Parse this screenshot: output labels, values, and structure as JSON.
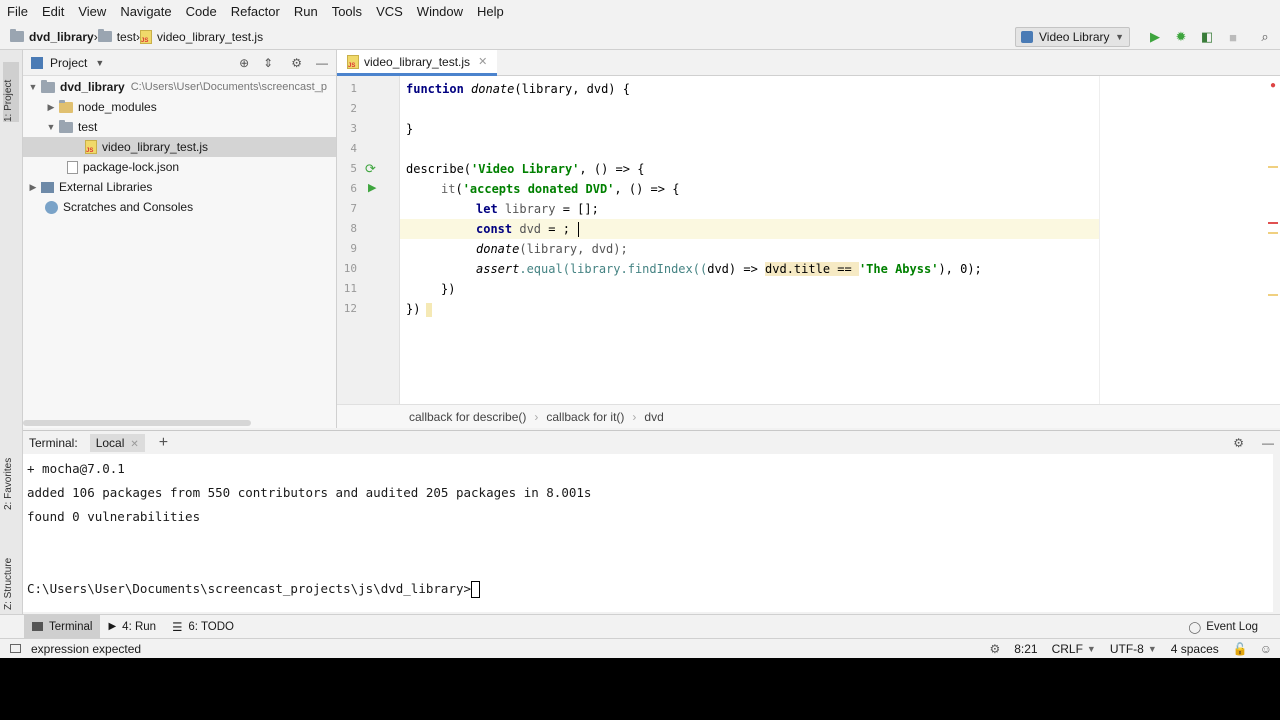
{
  "menu": [
    "File",
    "Edit",
    "View",
    "Navigate",
    "Code",
    "Refactor",
    "Run",
    "Tools",
    "VCS",
    "Window",
    "Help"
  ],
  "nav": {
    "project": "dvd_library",
    "folder": "test",
    "file": "video_library_test.js"
  },
  "run_config": "Video Library",
  "left_strip": {
    "project": "1: Project",
    "favorites": "2: Favorites",
    "structure": "Z: Structure"
  },
  "project_panel": {
    "title": "Project",
    "root": "dvd_library",
    "root_path": "C:\\Users\\User\\Documents\\screencast_p",
    "items": [
      "node_modules",
      "test",
      "video_library_test.js",
      "package-lock.json",
      "External Libraries",
      "Scratches and Consoles"
    ]
  },
  "editor": {
    "tab": "video_library_test.js",
    "line_numbers": [
      "1",
      "2",
      "3",
      "4",
      "5",
      "6",
      "7",
      "8",
      "9",
      "10",
      "11",
      "12"
    ],
    "code": {
      "l1_kw": "function",
      "l1_fn": "donate",
      "l1_rest": "(library, dvd) {",
      "l3": "}",
      "l5_fn": "describe",
      "l5_str": "'Video Library'",
      "l5_rest": ", () => {",
      "l6_fn": "it",
      "l6_str": "'accepts donated DVD'",
      "l6_rest": ", () => {",
      "l7_kw": "let",
      "l7_var": "library",
      "l7_rest": " = [];",
      "l8_kw": "const",
      "l8_var": "dvd",
      "l8_rest": " = ;",
      "l9_fn": "donate",
      "l9_rest": "(library, dvd);",
      "l10_fn": "assert",
      "l10_a": ".equal(",
      "l10_b": "library.findIndex((",
      "l10_c": "dvd",
      "l10_d": ") => ",
      "l10_e": "dvd.title == ",
      "l10_str": "'The Abyss'",
      "l10_f": "), 0);",
      "l11": "})",
      "l12": "})"
    }
  },
  "breadcrumbs": [
    "callback for describe()",
    "callback for it()",
    "dvd"
  ],
  "terminal": {
    "label": "Terminal:",
    "tab": "Local",
    "lines": [
      "+ mocha@7.0.1",
      "added 106 packages from 550 contributors and audited 205 packages in 8.001s",
      "found 0 vulnerabilities",
      "C:\\Users\\User\\Documents\\screencast_projects\\js\\dvd_library>"
    ]
  },
  "toolwindows": {
    "terminal": "Terminal",
    "run": "4: Run",
    "todo": "6: TODO",
    "event_log": "Event Log"
  },
  "status": {
    "message": "expression expected",
    "position": "8:21",
    "line_sep": "CRLF",
    "encoding": "UTF-8",
    "indent": "4 spaces"
  }
}
